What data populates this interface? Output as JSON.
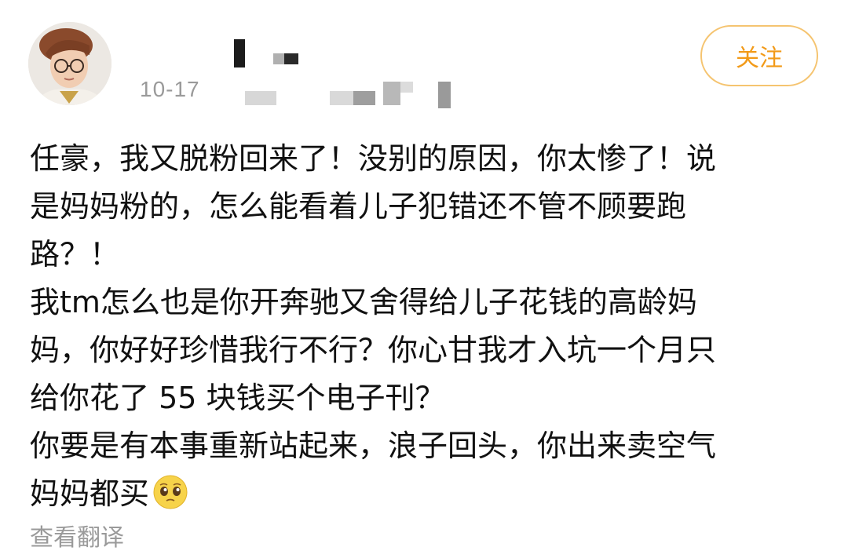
{
  "post": {
    "avatar_icon": "user-avatar",
    "time": "10-17",
    "follow_label": "关注",
    "content_lines": [
      "任豪，我又脱粉回来了！没别的原因，你太惨了！说",
      "是妈妈粉的，怎么能看着儿子犯错还不管不顾要跑",
      "路？！",
      "我tm怎么也是你开奔驰又舍得给儿子花钱的高龄妈",
      "妈，你好好珍惜我行不行？你心甘我才入坑一个月只",
      "给你花了 55 块钱买个电子刊？",
      "你要是有本事重新站起来，浪子回头，你出来卖空气",
      "妈妈都买"
    ],
    "emoji_icon": "pleading-face-icon",
    "translate_label": "查看翻译"
  },
  "colors": {
    "follow_accent": "#f29a18",
    "follow_border": "#f5c470",
    "muted_text": "#9a9a9a"
  }
}
